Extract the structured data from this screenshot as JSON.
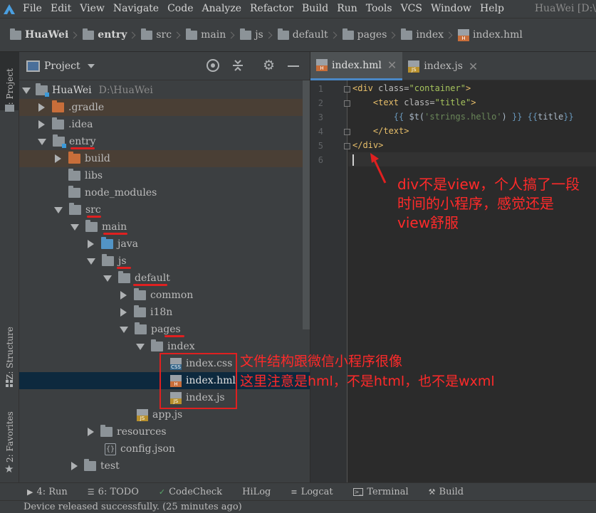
{
  "menu": {
    "items": [
      "File",
      "Edit",
      "View",
      "Navigate",
      "Code",
      "Analyze",
      "Refactor",
      "Build",
      "Run",
      "Tools",
      "VCS",
      "Window",
      "Help"
    ],
    "window_title": "HuaWei [D:\\"
  },
  "breadcrumb": [
    "HuaWei",
    "entry",
    "src",
    "main",
    "js",
    "default",
    "pages",
    "index",
    "index.hml"
  ],
  "side_tabs": {
    "project": "1: Project",
    "structure": "Z: Structure",
    "favorites": "2: Favorites"
  },
  "project_panel": {
    "title": "Project"
  },
  "tree": [
    {
      "label": "HuaWei",
      "path": "D:\\HuaWei"
    },
    {
      "label": ".gradle"
    },
    {
      "label": ".idea"
    },
    {
      "label": "entry"
    },
    {
      "label": "build"
    },
    {
      "label": "libs"
    },
    {
      "label": "node_modules"
    },
    {
      "label": "src"
    },
    {
      "label": "main"
    },
    {
      "label": "java"
    },
    {
      "label": "js"
    },
    {
      "label": "default"
    },
    {
      "label": "common"
    },
    {
      "label": "i18n"
    },
    {
      "label": "pages"
    },
    {
      "label": "index"
    },
    {
      "label": "index.css",
      "badge": "CSS"
    },
    {
      "label": "index.hml",
      "badge": "H"
    },
    {
      "label": "index.js",
      "badge": "JS"
    },
    {
      "label": "app.js",
      "badge": "JS"
    },
    {
      "label": "resources"
    },
    {
      "label": "config.json"
    },
    {
      "label": "test"
    }
  ],
  "editor": {
    "tabs": [
      {
        "label": "index.hml",
        "badge": "H"
      },
      {
        "label": "index.js",
        "badge": "JS"
      }
    ],
    "line_numbers": [
      "1",
      "2",
      "3",
      "4",
      "5",
      "6"
    ]
  },
  "annotations": {
    "top": [
      "div不是view，个人搞了一段",
      "时间的小程序，感觉还是",
      "view舒服"
    ],
    "middle": [
      "文件结构跟微信小程序很像",
      "这里注意是hml，不是html，也不是wxml"
    ]
  },
  "bottom_tools": [
    {
      "label": "4: Run"
    },
    {
      "label": "6: TODO"
    },
    {
      "label": "CodeCheck"
    },
    {
      "label": "HiLog"
    },
    {
      "label": "Logcat"
    },
    {
      "label": "Terminal"
    },
    {
      "label": "Build"
    }
  ],
  "status": {
    "message": "Device released successfully. (25 minutes ago)"
  },
  "colors": {
    "accent": "#4a88c7",
    "annotation": "#ff2a2a",
    "selection": "#0d293e"
  }
}
